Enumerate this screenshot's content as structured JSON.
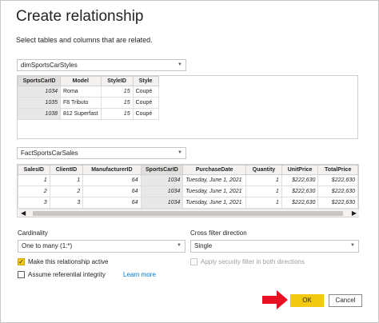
{
  "dialog": {
    "title": "Create relationship",
    "subtitle": "Select tables and columns that are related."
  },
  "table1": {
    "selected": "dimSportsCarStyles",
    "columns": [
      "SportsCarID",
      "Model",
      "StyleID",
      "Style"
    ],
    "rows": [
      [
        "1034",
        "Roma",
        "15",
        "Coupé"
      ],
      [
        "1035",
        "F8 Tributo",
        "15",
        "Coupé"
      ],
      [
        "1038",
        "812 Superfast",
        "15",
        "Coupé"
      ]
    ]
  },
  "table2": {
    "selected": "FactSportsCarSales",
    "columns": [
      "SalesID",
      "ClientID",
      "ManufacturerID",
      "SportsCarID",
      "PurchaseDate",
      "Quantity",
      "UnitPrice",
      "TotalPrice"
    ],
    "rows": [
      [
        "1",
        "1",
        "64",
        "1034",
        "Tuesday, June 1, 2021",
        "1",
        "$222,630",
        "$222,630"
      ],
      [
        "2",
        "2",
        "64",
        "1034",
        "Tuesday, June 1, 2021",
        "1",
        "$222,630",
        "$222,630"
      ],
      [
        "3",
        "3",
        "64",
        "1034",
        "Tuesday, June 1, 2021",
        "1",
        "$222,630",
        "$222,630"
      ]
    ]
  },
  "cardinality": {
    "label": "Cardinality",
    "value": "One to many (1:*)"
  },
  "cross_filter": {
    "label": "Cross filter direction",
    "value": "Single"
  },
  "options": {
    "active_label": "Make this relationship active",
    "active_checked": true,
    "referential_label": "Assume referential integrity",
    "referential_checked": false,
    "learn_more": "Learn more",
    "security_label": "Apply security filter in both directions",
    "security_checked": false
  },
  "buttons": {
    "ok": "OK",
    "cancel": "Cancel"
  },
  "colors": {
    "accent": "#f2c811",
    "link": "#0078d4",
    "arrow": "#e81123"
  }
}
